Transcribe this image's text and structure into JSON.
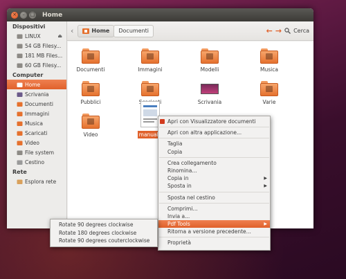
{
  "window": {
    "title": "Home"
  },
  "sidebar": {
    "sections": [
      {
        "title": "Dispositivi",
        "items": [
          {
            "label": "LINUX",
            "icon": "drive-icon",
            "eject": true
          },
          {
            "label": "54 GB Filesy...",
            "icon": "drive-icon"
          },
          {
            "label": "181 MB Files...",
            "icon": "drive-icon"
          },
          {
            "label": "60 GB Filesy...",
            "icon": "drive-icon"
          }
        ]
      },
      {
        "title": "Computer",
        "items": [
          {
            "label": "Home",
            "icon": "home-icon",
            "selected": true
          },
          {
            "label": "Scrivania",
            "icon": "desktop-icon"
          },
          {
            "label": "Documenti",
            "icon": "folder-icon"
          },
          {
            "label": "Immagini",
            "icon": "folder-icon"
          },
          {
            "label": "Musica",
            "icon": "folder-icon"
          },
          {
            "label": "Scaricati",
            "icon": "folder-icon"
          },
          {
            "label": "Video",
            "icon": "folder-icon"
          },
          {
            "label": "File system",
            "icon": "drive-icon"
          },
          {
            "label": "Cestino",
            "icon": "trash-icon"
          }
        ]
      },
      {
        "title": "Rete",
        "items": [
          {
            "label": "Esplora rete",
            "icon": "network-icon"
          }
        ]
      }
    ]
  },
  "toolbar": {
    "crumbs": [
      "Home",
      "Documenti"
    ],
    "search_label": "Cerca"
  },
  "files": [
    {
      "label": "Documenti",
      "icon": "folder-documents-icon"
    },
    {
      "label": "Immagini",
      "icon": "folder-pictures-icon"
    },
    {
      "label": "Modelli",
      "icon": "folder-templates-icon"
    },
    {
      "label": "Musica",
      "icon": "folder-music-icon"
    },
    {
      "label": "Pubblici",
      "icon": "folder-public-icon"
    },
    {
      "label": "Scaricati",
      "icon": "folder-download-icon"
    },
    {
      "label": "Scrivania",
      "icon": "desktop-icon"
    },
    {
      "label": "Varie",
      "icon": "folder-icon"
    },
    {
      "label": "Video",
      "icon": "folder-video-icon"
    },
    {
      "label": "manuale",
      "icon": "pdf-document-icon",
      "selected": true
    }
  ],
  "context_menu": {
    "items": [
      {
        "label": "Apri con Visualizzatore documenti",
        "icon": true
      },
      {
        "sep": true
      },
      {
        "label": "Apri con altra applicazione..."
      },
      {
        "sep": true
      },
      {
        "label": "Taglia"
      },
      {
        "label": "Copia"
      },
      {
        "sep": true
      },
      {
        "label": "Crea collegamento"
      },
      {
        "label": "Rinomina..."
      },
      {
        "label": "Copia in",
        "submenu": true
      },
      {
        "label": "Sposta in",
        "submenu": true
      },
      {
        "sep": true
      },
      {
        "label": "Sposta nel cestino"
      },
      {
        "sep": true
      },
      {
        "label": "Comprimi..."
      },
      {
        "label": "Invia a..."
      },
      {
        "label": "Pdf Tools",
        "submenu": true,
        "selected": true
      },
      {
        "label": "Ritorna a versione precedente..."
      },
      {
        "sep": true
      },
      {
        "label": "Proprietà"
      }
    ]
  },
  "submenu": {
    "items": [
      "Rotate 90 degrees clockwise",
      "Rotate 180 degrees clockwise",
      "Rotate 90 degrees couterclockwise"
    ]
  },
  "colors": {
    "accent": "#e0612b",
    "titlebar": "#3c3b37"
  }
}
